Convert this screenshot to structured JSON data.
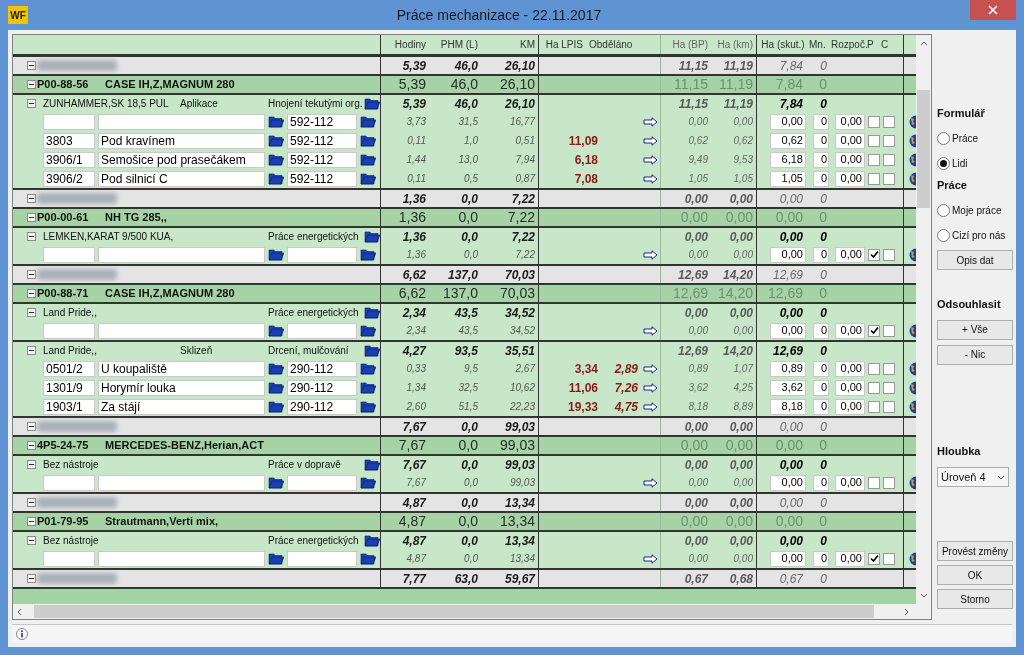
{
  "window": {
    "logo": "WF",
    "title": "Práce mechanizace - 22.11.2017"
  },
  "columns": {
    "h": "Hodiny",
    "phm": "PHM (L)",
    "km": "KM",
    "lpis": "Ha LPIS",
    "done": "Obděláno",
    "bp": "Ha (BP)",
    "hkm": "Ha (km)",
    "skut": "Ha (skut.)",
    "mn": "Mn.",
    "rozp": "Rozpoč.",
    "p": "P",
    "c": "C"
  },
  "groups": [
    {
      "totals": {
        "h": "5,39",
        "phm": "46,0",
        "km": "26,10",
        "bp": "11,15",
        "hkm": "11,19",
        "skut": "7,84",
        "mn": "0"
      },
      "vehicles": [
        {
          "code": "P00-88-56",
          "name": "CASE IH,Z,MAGNUM 280",
          "totals": {
            "h": "5,39",
            "phm": "46,0",
            "km": "26,10",
            "bp": "11,15",
            "hkm": "11,19",
            "skut": "7,84",
            "mn": "0"
          },
          "implements": [
            {
              "name": "ZUNHAMMER,SK 18,5 PUL",
              "operation": "Aplikace",
              "work": "Hnojení tekutými org.",
              "totals": {
                "h": "5,39",
                "phm": "46,0",
                "km": "26,10",
                "bp": "11,15",
                "hkm": "11,19",
                "skut": "7,84",
                "mn": "0"
              },
              "rows": [
                {
                  "code": "592-112",
                  "h": "3,73",
                  "phm": "31,5",
                  "km": "16,77",
                  "bp": "0,00",
                  "hkm": "0,00",
                  "skut": "0,00",
                  "mn": "0",
                  "rozp": "0,00",
                  "p": false,
                  "c": false
                },
                {
                  "parcel": "3803",
                  "place": "Pod kravínem",
                  "code": "592-112",
                  "h": "0,11",
                  "phm": "1,0",
                  "km": "0,51",
                  "lpis": "11,09",
                  "bp": "0,62",
                  "hkm": "0,62",
                  "skut": "0,62",
                  "mn": "0",
                  "rozp": "0,00",
                  "p": false,
                  "c": false
                },
                {
                  "parcel": "3906/1",
                  "place": "Semošice pod prasečákem",
                  "code": "592-112",
                  "h": "1,44",
                  "phm": "13,0",
                  "km": "7,94",
                  "lpis": "6,18",
                  "bp": "9,49",
                  "hkm": "9,53",
                  "skut": "6,18",
                  "mn": "0",
                  "rozp": "0,00",
                  "p": false,
                  "c": false
                },
                {
                  "parcel": "3906/2",
                  "place": "Pod silnicí C",
                  "code": "592-112",
                  "h": "0,11",
                  "phm": "0,5",
                  "km": "0,87",
                  "lpis": "7,08",
                  "bp": "1,05",
                  "hkm": "1,05",
                  "skut": "1,05",
                  "mn": "0",
                  "rozp": "0,00",
                  "p": false,
                  "c": false
                }
              ]
            }
          ]
        }
      ]
    },
    {
      "totals": {
        "h": "1,36",
        "phm": "0,0",
        "km": "7,22",
        "bp": "0,00",
        "hkm": "0,00",
        "skut": "0,00",
        "mn": "0"
      },
      "vehicles": [
        {
          "code": "P00-00-61",
          "name": "NH TG 285,,",
          "totals": {
            "h": "1,36",
            "phm": "0,0",
            "km": "7,22",
            "bp": "0,00",
            "hkm": "0,00",
            "skut": "0,00",
            "mn": "0"
          },
          "implements": [
            {
              "name": "LEMKEN,KARAT 9/500 KUA,",
              "work": "Práce energetických",
              "totals": {
                "h": "1,36",
                "phm": "0,0",
                "km": "7,22",
                "bp": "0,00",
                "hkm": "0,00",
                "skut": "0,00",
                "mn": "0"
              },
              "rows": [
                {
                  "h": "1,36",
                  "phm": "0,0",
                  "km": "7,22",
                  "bp": "0,00",
                  "hkm": "0,00",
                  "skut": "0,00",
                  "mn": "0",
                  "rozp": "0,00",
                  "p": true,
                  "c": false
                }
              ]
            }
          ]
        }
      ]
    },
    {
      "totals": {
        "h": "6,62",
        "phm": "137,0",
        "km": "70,03",
        "bp": "12,69",
        "hkm": "14,20",
        "skut": "12,69",
        "mn": "0"
      },
      "vehicles": [
        {
          "code": "P00-88-71",
          "name": "CASE IH,Z,MAGNUM 280",
          "totals": {
            "h": "6,62",
            "phm": "137,0",
            "km": "70,03",
            "bp": "12,69",
            "hkm": "14,20",
            "skut": "12,69",
            "mn": "0"
          },
          "implements": [
            {
              "name": "Land Pride,,",
              "work": "Práce energetických",
              "totals": {
                "h": "2,34",
                "phm": "43,5",
                "km": "34,52",
                "bp": "0,00",
                "hkm": "0,00",
                "skut": "0,00",
                "mn": "0"
              },
              "rows": [
                {
                  "h": "2,34",
                  "phm": "43,5",
                  "km": "34,52",
                  "bp": "0,00",
                  "hkm": "0,00",
                  "skut": "0,00",
                  "mn": "0",
                  "rozp": "0,00",
                  "p": true,
                  "c": false
                }
              ]
            },
            {
              "name": "Land Pride,,",
              "operation": "Sklizeň",
              "work": "Drcení, mulčování",
              "totals": {
                "h": "4,27",
                "phm": "93,5",
                "km": "35,51",
                "bp": "12,69",
                "hkm": "14,20",
                "skut": "12,69",
                "mn": "0"
              },
              "rows": [
                {
                  "parcel": "0501/2",
                  "place": "U koupaliště",
                  "code": "290-112",
                  "h": "0,33",
                  "phm": "9,5",
                  "km": "2,67",
                  "lpis": "3,34",
                  "done": "2,89",
                  "bp": "0,89",
                  "hkm": "1,07",
                  "skut": "0,89",
                  "mn": "0",
                  "rozp": "0,00",
                  "p": false,
                  "c": false
                },
                {
                  "parcel": "1301/9",
                  "place": "Horymír louka",
                  "code": "290-112",
                  "h": "1,34",
                  "phm": "32,5",
                  "km": "10,62",
                  "lpis": "11,06",
                  "done": "7,26",
                  "bp": "3,62",
                  "hkm": "4,25",
                  "skut": "3,62",
                  "mn": "0",
                  "rozp": "0,00",
                  "p": false,
                  "c": false
                },
                {
                  "parcel": "1903/1",
                  "place": "Za stájí",
                  "code": "290-112",
                  "h": "2,60",
                  "phm": "51,5",
                  "km": "22,23",
                  "lpis": "19,33",
                  "done": "4,75",
                  "bp": "8,18",
                  "hkm": "8,89",
                  "skut": "8,18",
                  "mn": "0",
                  "rozp": "0,00",
                  "p": false,
                  "c": false
                }
              ]
            }
          ]
        }
      ]
    },
    {
      "totals": {
        "h": "7,67",
        "phm": "0,0",
        "km": "99,03",
        "bp": "0,00",
        "hkm": "0,00",
        "skut": "0,00",
        "mn": "0"
      },
      "vehicles": [
        {
          "code": "4P5-24-75",
          "name": "MERCEDES-BENZ,Herian,ACT",
          "totals": {
            "h": "7,67",
            "phm": "0,0",
            "km": "99,03",
            "bp": "0,00",
            "hkm": "0,00",
            "skut": "0,00",
            "mn": "0"
          },
          "implements": [
            {
              "name": "Bez nástroje",
              "work": "Práce v dopravě",
              "totals": {
                "h": "7,67",
                "phm": "0,0",
                "km": "99,03",
                "bp": "0,00",
                "hkm": "0,00",
                "skut": "0,00",
                "mn": "0"
              },
              "rows": [
                {
                  "h": "7,67",
                  "phm": "0,0",
                  "km": "99,03",
                  "bp": "0,00",
                  "hkm": "0,00",
                  "skut": "0,00",
                  "mn": "0",
                  "rozp": "0,00",
                  "p": false,
                  "c": false
                }
              ]
            }
          ]
        }
      ]
    },
    {
      "totals": {
        "h": "4,87",
        "phm": "0,0",
        "km": "13,34",
        "bp": "0,00",
        "hkm": "0,00",
        "skut": "0,00",
        "mn": "0"
      },
      "vehicles": [
        {
          "code": "P01-79-95",
          "name": "Strautmann,Verti mix,",
          "totals": {
            "h": "4,87",
            "phm": "0,0",
            "km": "13,34",
            "bp": "0,00",
            "hkm": "0,00",
            "skut": "0,00",
            "mn": "0"
          },
          "implements": [
            {
              "name": "Bez nástroje",
              "work": "Práce energetických",
              "totals": {
                "h": "4,87",
                "phm": "0,0",
                "km": "13,34",
                "bp": "0,00",
                "hkm": "0,00",
                "skut": "0,00",
                "mn": "0"
              },
              "rows": [
                {
                  "h": "4,87",
                  "phm": "0,0",
                  "km": "13,34",
                  "bp": "0,00",
                  "hkm": "0,00",
                  "skut": "0,00",
                  "mn": "0",
                  "rozp": "0,00",
                  "p": true,
                  "c": false
                }
              ]
            }
          ]
        }
      ]
    },
    {
      "totals": {
        "h": "7,77",
        "phm": "63,0",
        "km": "59,67",
        "bp": "0,67",
        "hkm": "0,68",
        "skut": "0,67",
        "mn": "0"
      }
    }
  ],
  "panel": {
    "form_label": "Formulář",
    "form_options": [
      {
        "label": "Práce",
        "selected": false
      },
      {
        "label": "Lidi",
        "selected": true
      }
    ],
    "work_label": "Práce",
    "work_options": [
      {
        "label": "Moje práce",
        "selected": false
      },
      {
        "label": "Cizí pro nás",
        "selected": false
      }
    ],
    "copy_button": "Opis dat",
    "approve_label": "Odsouhlasit",
    "approve_buttons": [
      "+ Vše",
      "- Nic"
    ],
    "depth_label": "Hloubka",
    "depth_value": "Úroveň 4",
    "action_buttons": [
      "Provést změny",
      "OK",
      "Storno"
    ]
  }
}
